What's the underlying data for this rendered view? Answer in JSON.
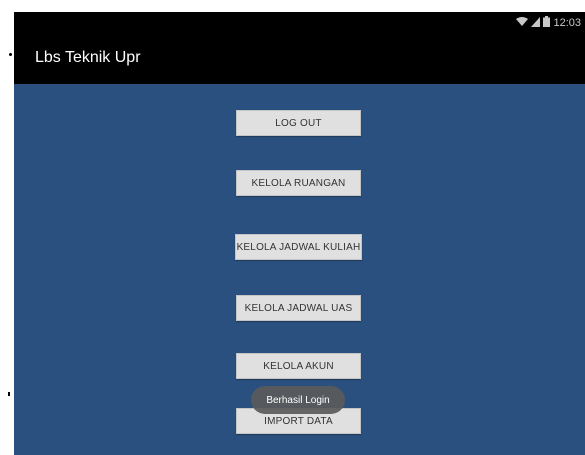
{
  "status_bar": {
    "time": "12:03",
    "wifi_icon": "wifi-icon",
    "signal_icon": "signal-icon",
    "battery_icon": "battery-icon"
  },
  "action_bar": {
    "title": "Lbs Teknik Upr"
  },
  "buttons": {
    "logout": "LOG OUT",
    "kelola_ruangan": "KELOLA RUANGAN",
    "kelola_jadwal_kuliah": "KELOLA JADWAL KULIAH",
    "kelola_jadwal_uas": "KELOLA JADWAL UAS",
    "kelola_akun": "KELOLA AKUN",
    "import_data": "IMPORT DATA"
  },
  "toast": {
    "message": "Berhasil Login"
  },
  "colors": {
    "background": "#2a5080",
    "action_bar": "#000000",
    "button": "#e0e0e0"
  }
}
